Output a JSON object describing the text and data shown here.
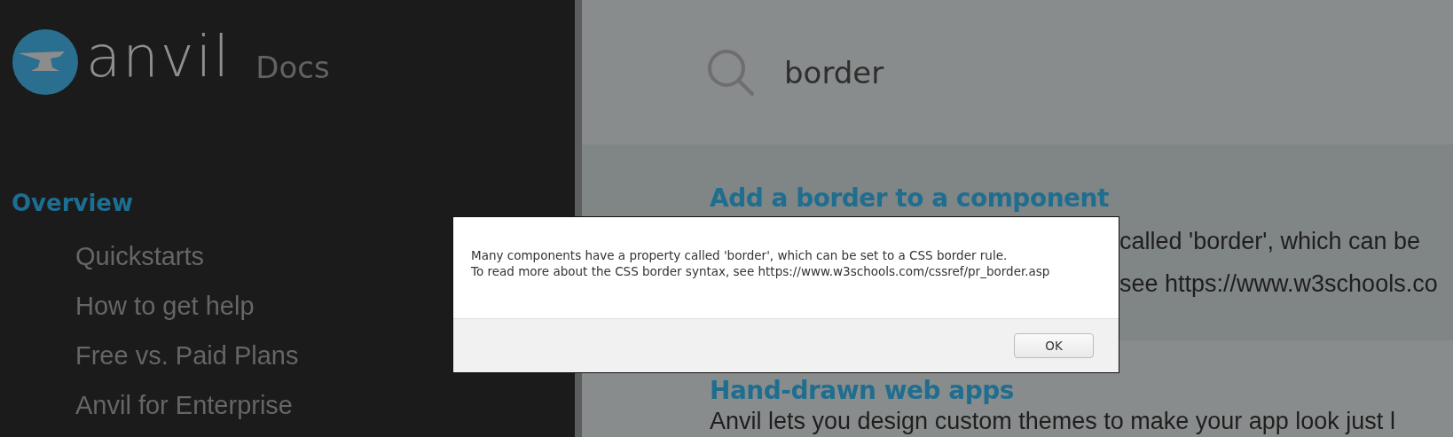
{
  "sidebar": {
    "logo": {
      "wordmark": "anvil",
      "suffix": "Docs"
    },
    "items": [
      {
        "label": "Overview",
        "selected": true
      },
      {
        "label": "Quickstarts",
        "selected": false
      },
      {
        "label": "How to get help",
        "selected": false
      },
      {
        "label": "Free vs. Paid Plans",
        "selected": false
      },
      {
        "label": "Anvil for Enterprise",
        "selected": false
      }
    ]
  },
  "search": {
    "value": "border"
  },
  "results": [
    {
      "title": "Add a border to a component",
      "lines": [
        "called 'border', which can be",
        "see https://www.w3schools.co"
      ],
      "selected": true
    },
    {
      "title": "Hand-drawn web apps",
      "lines": [
        "Anvil lets you design custom themes to make your app look just l"
      ],
      "selected": false
    }
  ],
  "dialog": {
    "message": "Many components have a property called 'border', which can be set to a CSS border rule.\nTo read more about the CSS border syntax, see https://www.w3schools.com/cssref/pr_border.asp",
    "buttons": [
      "OK"
    ]
  }
}
